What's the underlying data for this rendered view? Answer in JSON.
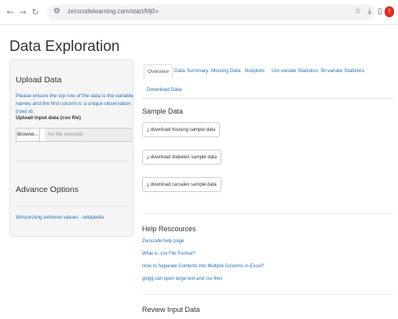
{
  "browser": {
    "url": "zerocodelearning.com/start/Mj0=",
    "icons": [
      "back-icon",
      "forward-icon",
      "reload-icon",
      "site-info-icon",
      "star-icon",
      "download-icon",
      "reading-list-icon",
      "profile-icon"
    ]
  },
  "page": {
    "title": "Data Exploration"
  },
  "sidebar": {
    "upload_heading": "Upload Data",
    "upload_note": "Please ensure the top row of the data is the variable names and the first column is a unique observation (row) id.",
    "input_label": "Upload input data (csv file)",
    "browse_label": "Browse...",
    "file_status": "No file selected",
    "advance_heading": "Advance Options",
    "winsorizing_link": "Winsorizing extreme values - wikipedia"
  },
  "tabs": [
    {
      "label": "Overview",
      "active": true
    },
    {
      "label": "Data Summary",
      "active": false
    },
    {
      "label": "Missing Data",
      "active": false
    },
    {
      "label": "Boxplots",
      "active": false
    },
    {
      "label": "Uni-variate Statistics",
      "active": false
    },
    {
      "label": "Bi-variate Statistics",
      "active": false
    },
    {
      "label": "Download Data",
      "active": false
    }
  ],
  "sample_data": {
    "title": "Sample Data",
    "buttons": [
      "download housing sample data",
      "download diabetes sample data",
      "download carsales sample data"
    ]
  },
  "help": {
    "title": "Help Rescources",
    "links": [
      "Zerocode help page",
      "What is .csv File Format?",
      "How to Separate Contents into Multiple Columns in Excel?",
      "glogg can open large text and csv files"
    ]
  },
  "review": {
    "title": "Review Input Data"
  },
  "colors": {
    "link": "#2a6ebb",
    "sidebar_bg": "#f5f5f5",
    "profile": "#d93025"
  }
}
